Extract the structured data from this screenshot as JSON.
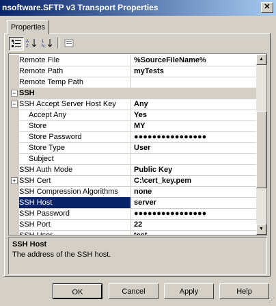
{
  "window": {
    "title": "nsoftware.SFTP v3 Transport Properties",
    "close_glyph": "✕"
  },
  "tabs": [
    {
      "label": "Properties"
    }
  ],
  "toolbar": {
    "icons": [
      "categorized-icon",
      "alphabetical-icon",
      "sort-numeric-icon",
      "property-pages-icon"
    ]
  },
  "grid": {
    "rows": [
      {
        "name": "Remote File",
        "value": "%SourceFileName%",
        "type": "prop"
      },
      {
        "name": "Remote Path",
        "value": "myTests",
        "type": "prop"
      },
      {
        "name": "Remote Temp Path",
        "value": "",
        "type": "prop"
      },
      {
        "name": "SSH",
        "value": "",
        "type": "cat",
        "toggle": "⊟"
      },
      {
        "name": "SSH Accept Server Host Key",
        "value": "Any",
        "type": "prop",
        "toggle": "⊟"
      },
      {
        "name": "Accept Any",
        "value": "Yes",
        "type": "sub"
      },
      {
        "name": "Store",
        "value": "MY",
        "type": "sub"
      },
      {
        "name": "Store Password",
        "value": "●●●●●●●●●●●●●●●●",
        "type": "sub"
      },
      {
        "name": "Store Type",
        "value": "User",
        "type": "sub"
      },
      {
        "name": "Subject",
        "value": "",
        "type": "sub"
      },
      {
        "name": "SSH Auth Mode",
        "value": "Public Key",
        "type": "prop"
      },
      {
        "name": "SSH Cert",
        "value": "C:\\cert_key.pem",
        "type": "prop",
        "toggle": "⊞"
      },
      {
        "name": "SSH Compression Algorithms",
        "value": "none",
        "type": "prop"
      },
      {
        "name": "SSH Host",
        "value": "server",
        "type": "prop",
        "selected": true
      },
      {
        "name": "SSH Password",
        "value": "●●●●●●●●●●●●●●●●",
        "type": "prop"
      },
      {
        "name": "SSH Port",
        "value": "22",
        "type": "prop"
      },
      {
        "name": "SSH User",
        "value": "test",
        "type": "prop"
      }
    ]
  },
  "description": {
    "title": "SSH Host",
    "text": "The address of the SSH host."
  },
  "buttons": {
    "ok": "OK",
    "cancel": "Cancel",
    "apply": "Apply",
    "help": "Help"
  }
}
